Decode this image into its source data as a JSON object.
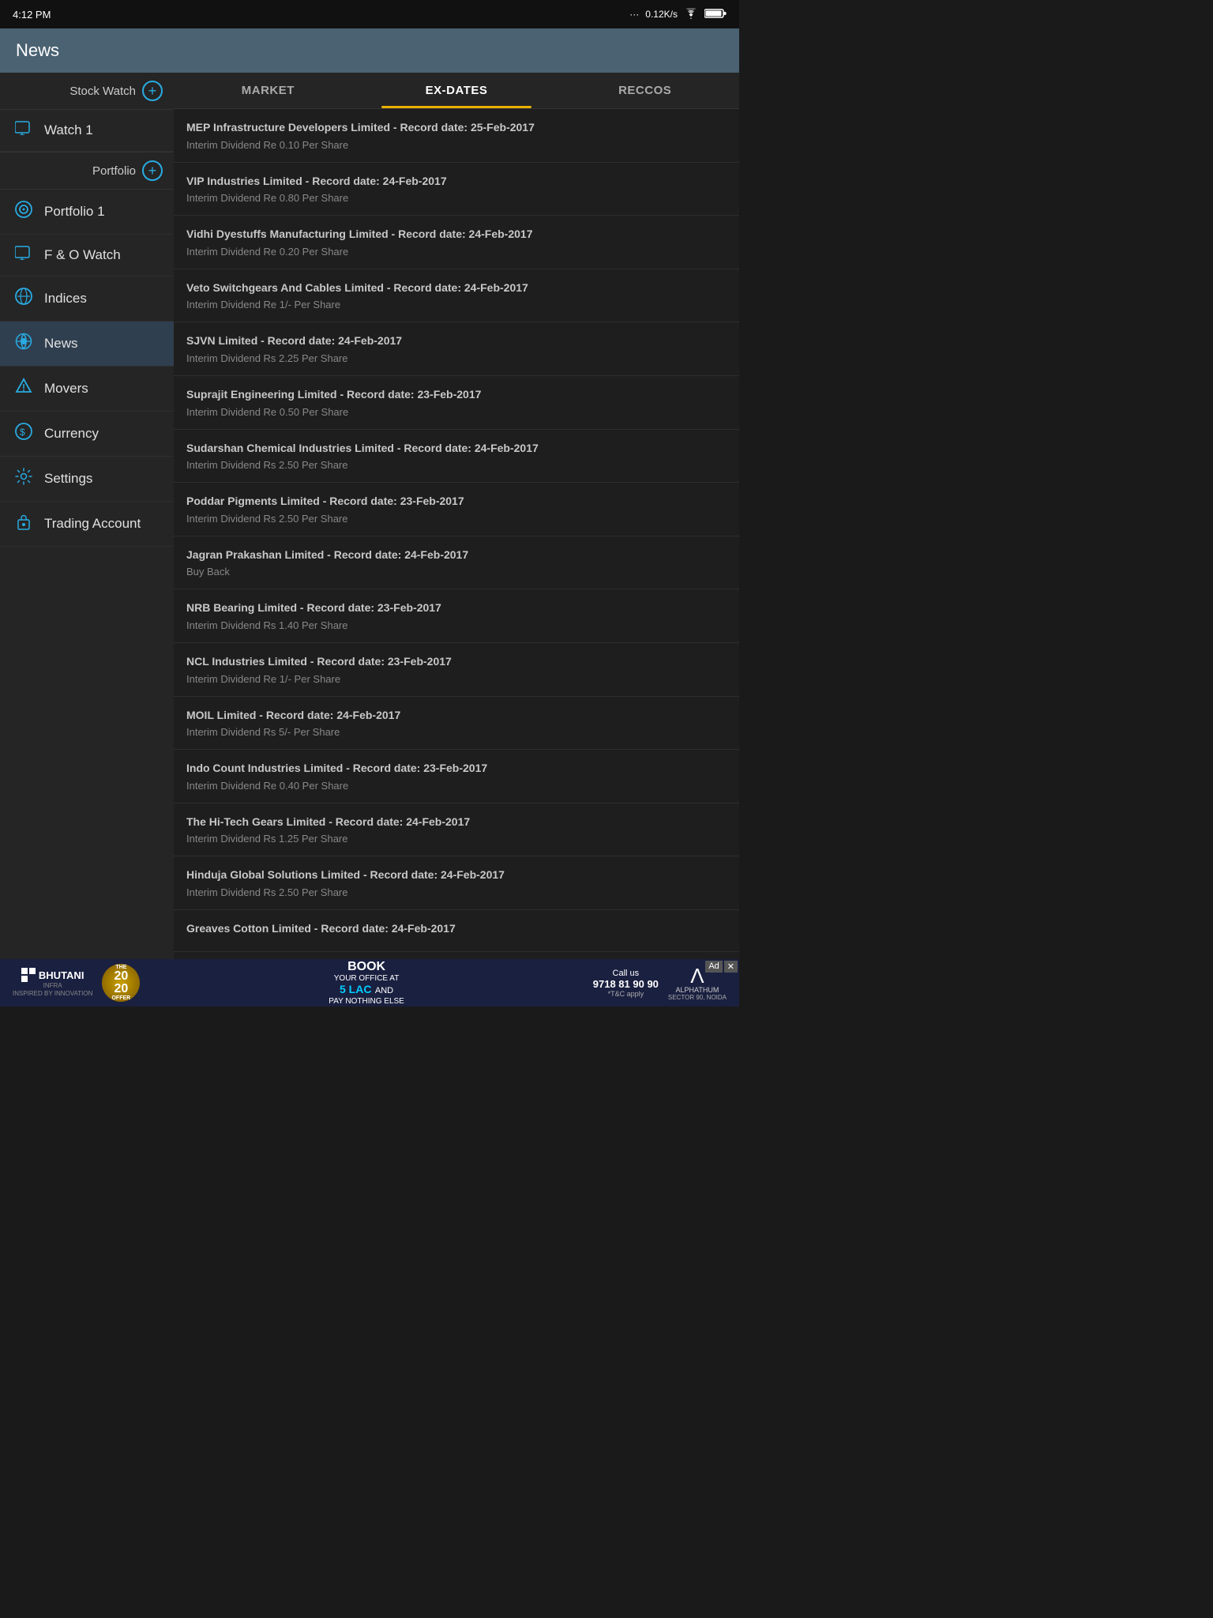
{
  "statusBar": {
    "time": "4:12 PM",
    "signal": "...",
    "speed": "0.12K/s",
    "wifi": "wifi",
    "battery": "battery"
  },
  "header": {
    "title": "News"
  },
  "sidebar": {
    "stockWatch": {
      "label": "Stock Watch"
    },
    "items": [
      {
        "id": "watch1",
        "label": "Watch 1",
        "icon": "🖥"
      },
      {
        "id": "portfolio1",
        "label": "Portfolio 1",
        "icon": "⚙"
      },
      {
        "id": "fo-watch",
        "label": "F & O Watch",
        "icon": "🖥"
      },
      {
        "id": "indices",
        "label": "Indices",
        "icon": "🌐"
      },
      {
        "id": "news",
        "label": "News",
        "icon": "📡",
        "active": true
      },
      {
        "id": "movers",
        "label": "Movers",
        "icon": "⬆"
      },
      {
        "id": "currency",
        "label": "Currency",
        "icon": "💲"
      },
      {
        "id": "settings",
        "label": "Settings",
        "icon": "⚙"
      },
      {
        "id": "trading-account",
        "label": "Trading Account",
        "icon": "🔒"
      }
    ],
    "portfolio": {
      "label": "Portfolio"
    }
  },
  "tabs": [
    {
      "id": "market",
      "label": "MARKET",
      "active": false
    },
    {
      "id": "ex-dates",
      "label": "EX-DATES",
      "active": true
    },
    {
      "id": "reccos",
      "label": "RECCOS",
      "active": false
    }
  ],
  "newsList": [
    {
      "title": "MEP Infrastructure Developers Limited - Record date: 25-Feb-2017",
      "subtitle": "Interim Dividend Re 0.10 Per Share"
    },
    {
      "title": "VIP Industries Limited - Record date: 24-Feb-2017",
      "subtitle": "Interim Dividend Re 0.80 Per Share"
    },
    {
      "title": "Vidhi Dyestuffs Manufacturing Limited - Record date: 24-Feb-2017",
      "subtitle": "Interim Dividend Re 0.20 Per Share"
    },
    {
      "title": "Veto Switchgears And Cables Limited - Record date: 24-Feb-2017",
      "subtitle": "Interim Dividend Re 1/- Per Share"
    },
    {
      "title": "SJVN Limited - Record date: 24-Feb-2017",
      "subtitle": "Interim Dividend Rs 2.25 Per Share"
    },
    {
      "title": "Suprajit Engineering Limited - Record date: 23-Feb-2017",
      "subtitle": "Interim Dividend Re 0.50 Per Share"
    },
    {
      "title": "Sudarshan Chemical Industries Limited - Record date: 24-Feb-2017",
      "subtitle": "Interim Dividend Rs 2.50 Per Share"
    },
    {
      "title": "Poddar Pigments Limited - Record date: 23-Feb-2017",
      "subtitle": "Interim Dividend Rs 2.50 Per Share"
    },
    {
      "title": "Jagran Prakashan Limited - Record date: 24-Feb-2017",
      "subtitle": "Buy Back"
    },
    {
      "title": "NRB Bearing Limited - Record date: 23-Feb-2017",
      "subtitle": "Interim Dividend Rs 1.40 Per Share"
    },
    {
      "title": "NCL Industries Limited - Record date: 23-Feb-2017",
      "subtitle": "Interim Dividend Re 1/- Per Share"
    },
    {
      "title": "MOIL Limited - Record date: 24-Feb-2017",
      "subtitle": "Interim Dividend Rs 5/- Per Share"
    },
    {
      "title": "Indo Count Industries Limited - Record date: 23-Feb-2017",
      "subtitle": "Interim Dividend Re 0.40 Per Share"
    },
    {
      "title": "The Hi-Tech Gears Limited - Record date: 24-Feb-2017",
      "subtitle": "Interim Dividend Rs 1.25 Per Share"
    },
    {
      "title": "Hinduja Global Solutions Limited - Record date: 24-Feb-2017",
      "subtitle": "Interim Dividend Rs 2.50 Per Share"
    },
    {
      "title": "Greaves Cotton Limited - Record date: 24-Feb-2017",
      "subtitle": ""
    }
  ],
  "ad": {
    "logoName": "BHUTANI",
    "logoSub": "INFRA\nINSPIRED BY INNOVATION",
    "badgeLine1": "THE",
    "badgeLine2": "20",
    "badgeLine3": "20",
    "badgeLine4": "OFFER",
    "mainText1": "BOOK",
    "mainText2": "YOUR OFFICE AT",
    "mainText3": "5 LAC",
    "mainText4": "AND",
    "mainText5": "PAY NOTHING ELSE",
    "callText": "Call us",
    "phoneNumber": "9718 81 90 90",
    "tcText": "*T&C apply",
    "rightLogoLetter": "Λ",
    "rightLogoName": "ALPHATHUM",
    "rightLogoSector": "SECTOR 90, NOIDA",
    "adLabel": "Ad"
  }
}
